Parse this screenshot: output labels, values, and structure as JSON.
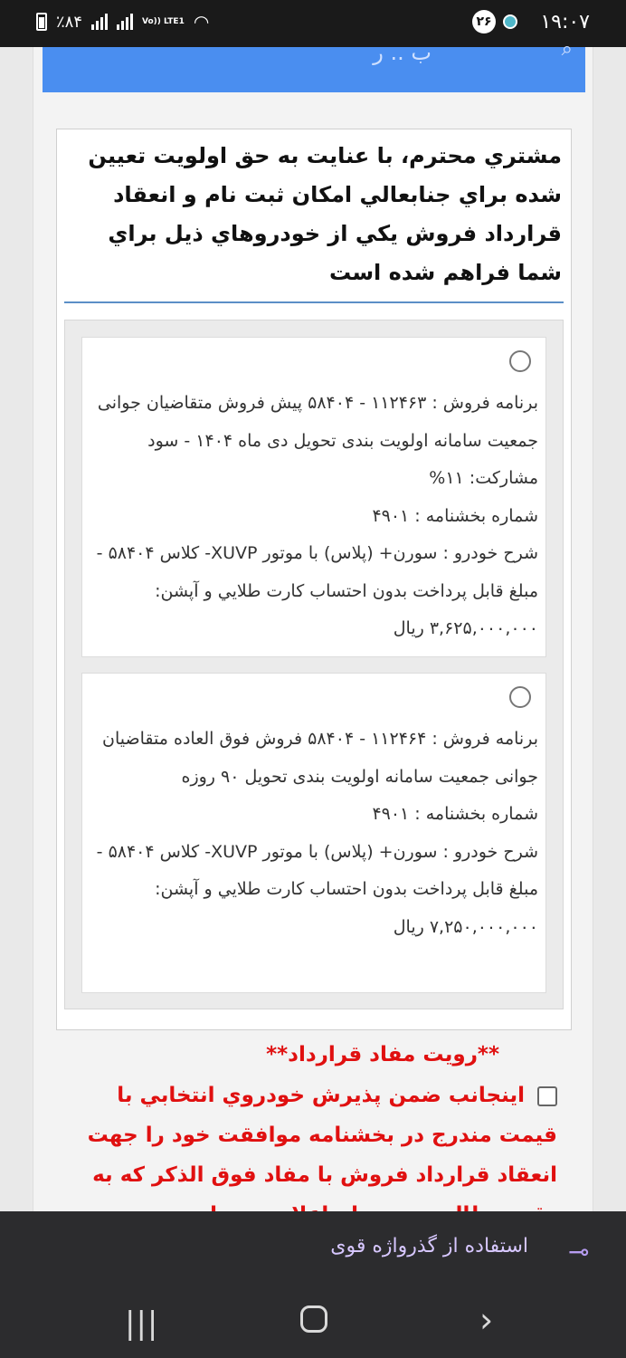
{
  "status": {
    "time": "۱۹:۰۷",
    "notifications": "۲۶",
    "battery": "٪۸۴",
    "network": "Vo)) LTE1"
  },
  "header": {
    "title": "ب  ..  ر"
  },
  "intro": {
    "text": "مشتري محترم، با عنايت به حق اولويت تعيين شده براي جنابعالي امكان ثبت نام و انعقاد قرارداد فروش يكي از خودروهاي ذيل براي شما فراهم شده است"
  },
  "options": [
    {
      "program": "برنامه فروش : ۱۱۲۴۶۳ - ۵۸۴۰۴ پیش فروش متقاضیان جوانی جمعیت سامانه اولویت بندی تحویل دی ماه ۱۴۰۴ - سود مشارکت: ۱۱%",
      "circular": "شماره بخشنامه : ۴۹۰۱",
      "description": "شرح خودرو : سورن+ (پلاس) با موتور XUVP- کلاس ۵۸۴۰۴ - مبلغ قابل پرداخت بدون احتساب کارت طلايي و آپشن: ۳,۶۲۵,۰۰۰,۰۰۰ ريال"
    },
    {
      "program": "برنامه فروش : ۱۱۲۴۶۴ - ۵۸۴۰۴ فروش فوق العاده متقاضیان جوانی جمعیت سامانه اولویت بندی تحویل ۹۰ روزه",
      "circular": "شماره بخشنامه : ۴۹۰۱",
      "description": "شرح خودرو : سورن+ (پلاس) با موتور XUVP- کلاس ۵۸۴۰۴ - مبلغ قابل پرداخت بدون احتساب کارت طلايي و آپشن: ۷,۲۵۰,۰۰۰,۰۰۰ ريال"
    }
  ],
  "terms": {
    "title": "**رويت مفاد قرارداد**",
    "agreement": "اينجانب ضمن پذيرش خودروي انتخابي با قيمت مندرج در بخشنامه موافقت خود را جهت انعقاد قرارداد فروش با مفاد فوق الذكر كه به دقت مطالعه نموده ام اعلام مي دارم"
  },
  "keyboard_bar": {
    "suggestion": "استفاده از گذرواژه قوی"
  }
}
